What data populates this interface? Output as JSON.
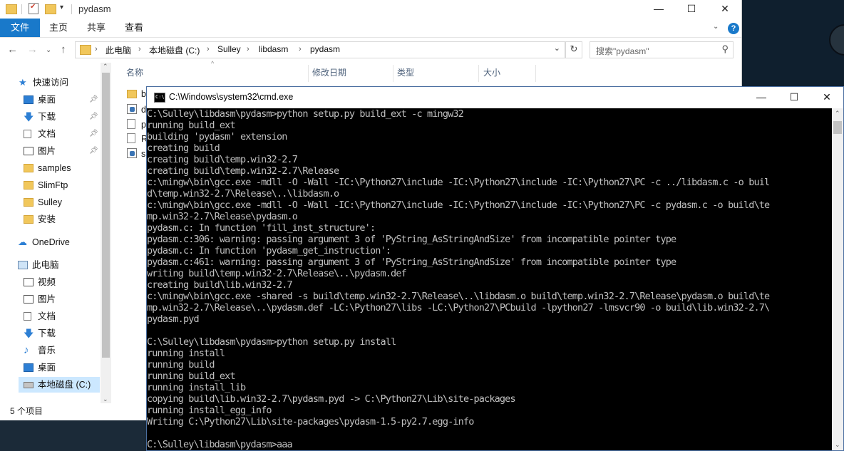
{
  "explorer": {
    "title": "pydasm",
    "ribbon_tabs": [
      "文件",
      "主页",
      "共享",
      "查看"
    ],
    "help": "?",
    "breadcrumb": [
      "此电脑",
      "本地磁盘 (C:)",
      "Sulley",
      "libdasm",
      "pydasm"
    ],
    "search_placeholder": "搜索\"pydasm\"",
    "columns": [
      "名称",
      "修改日期",
      "类型",
      "大小"
    ],
    "files": [
      {
        "name": "b",
        "icon": "folder-icon"
      },
      {
        "name": "d",
        "icon": "python-file-icon"
      },
      {
        "name": "p",
        "icon": "text-file-icon"
      },
      {
        "name": "R",
        "icon": "text-file-icon"
      },
      {
        "name": "s",
        "icon": "python-file-icon"
      }
    ],
    "nav": {
      "quick_access": "快速访问",
      "quick_items": [
        "桌面",
        "下载",
        "文档",
        "图片",
        "samples",
        "SlimFtp",
        "Sulley",
        "安装"
      ],
      "onedrive": "OneDrive",
      "this_pc": "此电脑",
      "pc_items": [
        "视频",
        "图片",
        "文档",
        "下载",
        "音乐",
        "桌面",
        "本地磁盘 (C:)"
      ]
    },
    "status": "5 个项目"
  },
  "cmd": {
    "title": "C:\\Windows\\system32\\cmd.exe",
    "lines": [
      "C:\\Sulley\\libdasm\\pydasm>python setup.py build_ext -c mingw32",
      "running build_ext",
      "building 'pydasm' extension",
      "creating build",
      "creating build\\temp.win32-2.7",
      "creating build\\temp.win32-2.7\\Release",
      "c:\\mingw\\bin\\gcc.exe -mdll -O -Wall -IC:\\Python27\\include -IC:\\Python27\\include -IC:\\Python27\\PC -c ../libdasm.c -o buil",
      "d\\temp.win32-2.7\\Release\\..\\libdasm.o",
      "c:\\mingw\\bin\\gcc.exe -mdll -O -Wall -IC:\\Python27\\include -IC:\\Python27\\include -IC:\\Python27\\PC -c pydasm.c -o build\\te",
      "mp.win32-2.7\\Release\\pydasm.o",
      "pydasm.c: In function 'fill_inst_structure':",
      "pydasm.c:306: warning: passing argument 3 of 'PyString_AsStringAndSize' from incompatible pointer type",
      "pydasm.c: In function 'pydasm_get_instruction':",
      "pydasm.c:461: warning: passing argument 3 of 'PyString_AsStringAndSize' from incompatible pointer type",
      "writing build\\temp.win32-2.7\\Release\\..\\pydasm.def",
      "creating build\\lib.win32-2.7",
      "c:\\mingw\\bin\\gcc.exe -shared -s build\\temp.win32-2.7\\Release\\..\\libdasm.o build\\temp.win32-2.7\\Release\\pydasm.o build\\te",
      "mp.win32-2.7\\Release\\..\\pydasm.def -LC:\\Python27\\libs -LC:\\Python27\\PCbuild -lpython27 -lmsvcr90 -o build\\lib.win32-2.7\\",
      "pydasm.pyd",
      "",
      "C:\\Sulley\\libdasm\\pydasm>python setup.py install",
      "running install",
      "running build",
      "running build_ext",
      "running install_lib",
      "copying build\\lib.win32-2.7\\pydasm.pyd -> C:\\Python27\\Lib\\site-packages",
      "running install_egg_info",
      "Writing C:\\Python27\\Lib\\site-packages\\pydasm-1.5-py2.7.egg-info",
      "",
      "C:\\Sulley\\libdasm\\pydasm>aaa"
    ]
  },
  "desktop": {
    "widget_top": "",
    "widget_bottom": ""
  }
}
